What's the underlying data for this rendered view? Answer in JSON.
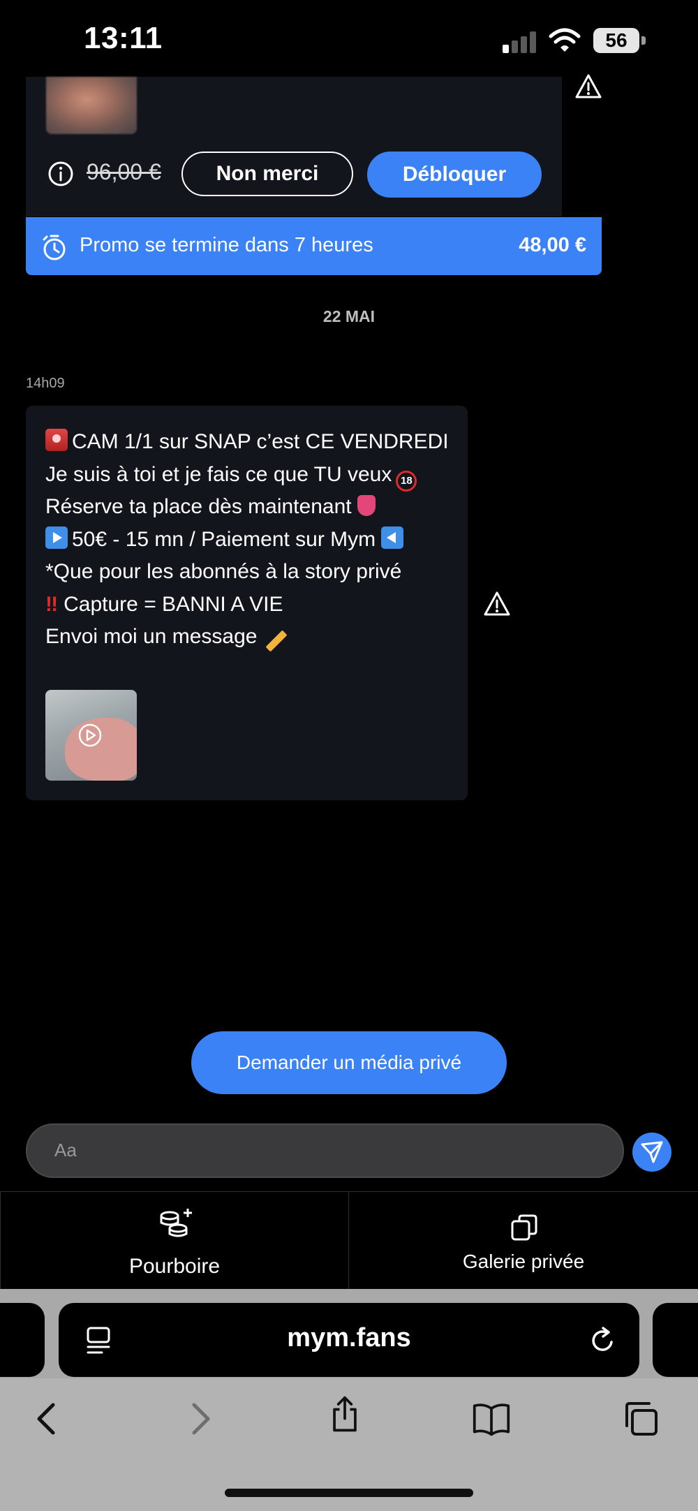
{
  "status_bar": {
    "time": "13:11",
    "battery": "56"
  },
  "unlock_card": {
    "old_price": "96,00 €",
    "decline_label": "Non merci",
    "unlock_label": "Débloquer",
    "promo_text": "Promo se termine dans 7 heures",
    "promo_price": "48,00 €"
  },
  "conversation": {
    "date_separator": "22 MAI",
    "message_time": "14h09",
    "message_lines": [
      "CAM 1/1 sur SNAP c’est CE VENDREDI",
      "Je suis à toi et je fais ce que TU veux",
      "Réserve ta place dès maintenant",
      "50€ - 15 mn / Paiement sur Mym",
      "*Que pour les abonnés à la story privé",
      "Capture = BANNI A VIE",
      "Envoi moi un message"
    ],
    "emoji_18": "18",
    "emoji_bang": "‼"
  },
  "request_button": "Demander un média privé",
  "composer": {
    "placeholder": "Aa"
  },
  "tabs": {
    "tip": "Pourboire",
    "gallery": "Galerie privée"
  },
  "browser": {
    "url": "mym.fans"
  },
  "colors": {
    "accent": "#3b82f6",
    "bubble": "#12151c",
    "background": "#000000"
  }
}
